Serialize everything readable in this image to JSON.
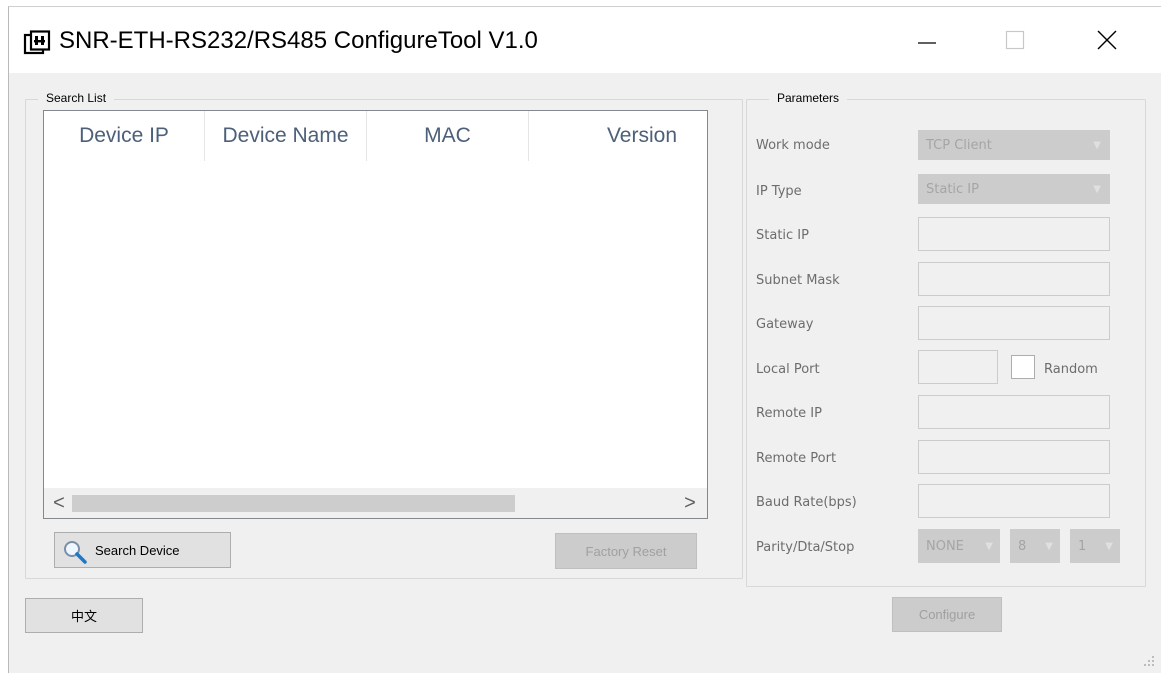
{
  "window": {
    "title": "SNR-ETH-RS232/RS485 ConfigureTool V1.0"
  },
  "search_list": {
    "legend": "Search List",
    "columns": [
      "Device IP",
      "Device Name",
      "MAC",
      "Version"
    ],
    "rows": [],
    "scroll_left": "<",
    "scroll_right": ">"
  },
  "buttons": {
    "search_device": "Search Device",
    "factory_reset": "Factory Reset",
    "language": "中文",
    "configure": "Configure"
  },
  "parameters": {
    "legend": "Parameters",
    "work_mode": {
      "label": "Work mode",
      "value": "TCP Client"
    },
    "ip_type": {
      "label": "IP Type",
      "value": "Static IP"
    },
    "static_ip": {
      "label": "Static IP",
      "value": ""
    },
    "subnet_mask": {
      "label": "Subnet Mask",
      "value": ""
    },
    "gateway": {
      "label": "Gateway",
      "value": ""
    },
    "local_port": {
      "label": "Local Port",
      "value": "",
      "random_label": "Random",
      "random_checked": false
    },
    "remote_ip": {
      "label": "Remote IP",
      "value": ""
    },
    "remote_port": {
      "label": "Remote Port",
      "value": ""
    },
    "baud_rate": {
      "label": "Baud Rate(bps)",
      "value": ""
    },
    "parity_data_stop": {
      "label": "Parity/Dta/Stop",
      "parity": "NONE",
      "data_bits": "8",
      "stop_bits": "1"
    }
  },
  "icons": {
    "app": "network-config-icon",
    "minimize": "minimize-icon",
    "maximize": "maximize-icon",
    "close": "close-icon",
    "search": "magnifier-icon",
    "resize": "resize-grip-icon"
  },
  "colors": {
    "window_bg": "#f0f0f0",
    "header_text": "#4c607a",
    "disabled_field": "#cccccc",
    "disabled_text": "#a0a0a0"
  }
}
